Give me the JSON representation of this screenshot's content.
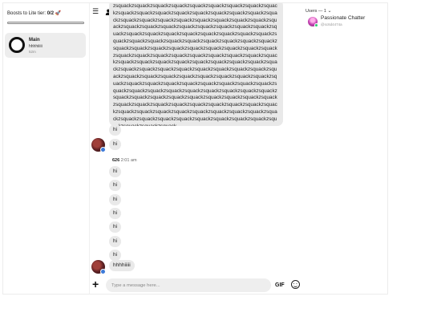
{
  "boosts": {
    "prefix": "Boosts to Lite tier: ",
    "value": "0/2",
    "icon": "rocket-icon",
    "progress_fraction": 0
  },
  "rooms": [
    {
      "name": "Main",
      "preview": "hhhhiiiii",
      "time": "52m"
    }
  ],
  "header": {
    "icons": [
      "hamburger-menu-icon",
      "user-icon",
      "settings-icon"
    ]
  },
  "messages": {
    "long_text": "zsquackzsquackzsquackzsquackzsquackzsquackzsquackzsquackzsquackzsquackzsquackzsquackzsquackzsquackzsquackzsquackzsquackzsquackzsquackzsquackzsquackzsquackzsquackzsquackzsquackzsquackzsquackzsquackzsquackzsquackzsquackzsquackzsquackzsquackzsquackzsquackzsquackzsquackzsquackzsquackzsquackzsquackzsquackzsquackzsquackzsquackzsquackzsquackzsquackzsquackzsquackzsquackzsquackzsquackzsquackzsquackzsquackzsquackzsquackzsquackzsquackzsquackzsquackzsquackzsquackzsquackzsquackzsquackzsquackzsquackzsquackzsquackzsquackzsquackzsquackzsquackzsquackzsquackzsquackzsquackzsquackzsquackzsquackzsquackzsquackzsquackzsquackzsquackzsquackzsquackzsquackzsquackzsquackzsquackzsquackzsquackzsquackzsquackzsquackzsquackzsquackzsquackzsquackzsquackzsquackzsquackzsquackzsquackzsquackzsquackzsquackzsquackzsquackzsquackzsquackzsquackzsquackzsquackzsquackzsquackzsquackzsquackzsquackzsquackzsquackzsquackzsquackzsquackzsquackzsquackzsquackzsquackzsquackzsquackzsquackzsquackzsquackzsquackzsquackzsquackzsquackzsquackzsquackzsquackzsquackzsquackzsquackzsquackzsquackzsquackzsquackzsquackzsquackzsquack",
    "group1_text": "hi",
    "group1_second": "hi",
    "group2_author": "626",
    "group2_time": "2:01 am",
    "group2_items": [
      "hi",
      "hi",
      "hi",
      "hi",
      "hi",
      "hi",
      "hi"
    ],
    "last_text": "hhhhiiiii"
  },
  "composer": {
    "placeholder": "Type a message here...",
    "gif_label": "GIF",
    "plus_icon": "plus-icon",
    "emoji_icon": "emoji-icon"
  },
  "users": {
    "header": "Users — 1",
    "list": [
      {
        "name": "Passionate Chatter",
        "handle": "@sc6d4474a"
      }
    ]
  }
}
